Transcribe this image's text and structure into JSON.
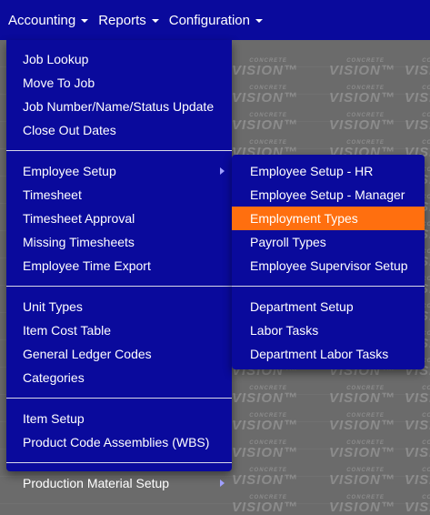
{
  "navbar": {
    "items": [
      {
        "label": "Accounting"
      },
      {
        "label": "Reports"
      },
      {
        "label": "Configuration"
      }
    ]
  },
  "watermark": {
    "small": "CONCRETE",
    "big": "VISION™"
  },
  "main_menu": {
    "group1": [
      "Job Lookup",
      "Move To Job",
      "Job Number/Name/Status Update",
      "Close Out Dates"
    ],
    "group2": [
      "Employee Setup",
      "Timesheet",
      "Timesheet Approval",
      "Missing Timesheets",
      "Employee Time Export"
    ],
    "group3": [
      "Unit Types",
      "Item Cost Table",
      "General Ledger Codes",
      "Categories"
    ],
    "group4": [
      "Item Setup",
      "Product Code Assemblies (WBS)"
    ],
    "group5": [
      "Production Material Setup"
    ]
  },
  "sub_menu": {
    "group1": [
      "Employee Setup - HR",
      "Employee Setup - Manager",
      "Employment Types",
      "Payroll Types",
      "Employee Supervisor Setup"
    ],
    "group2": [
      "Department Setup",
      "Labor Tasks",
      "Department Labor Tasks"
    ],
    "active_item": "Employment Types"
  },
  "colors": {
    "navbar": "#0a0a9c",
    "highlight": "#ff6f0f",
    "background": "#6b6b6b"
  }
}
